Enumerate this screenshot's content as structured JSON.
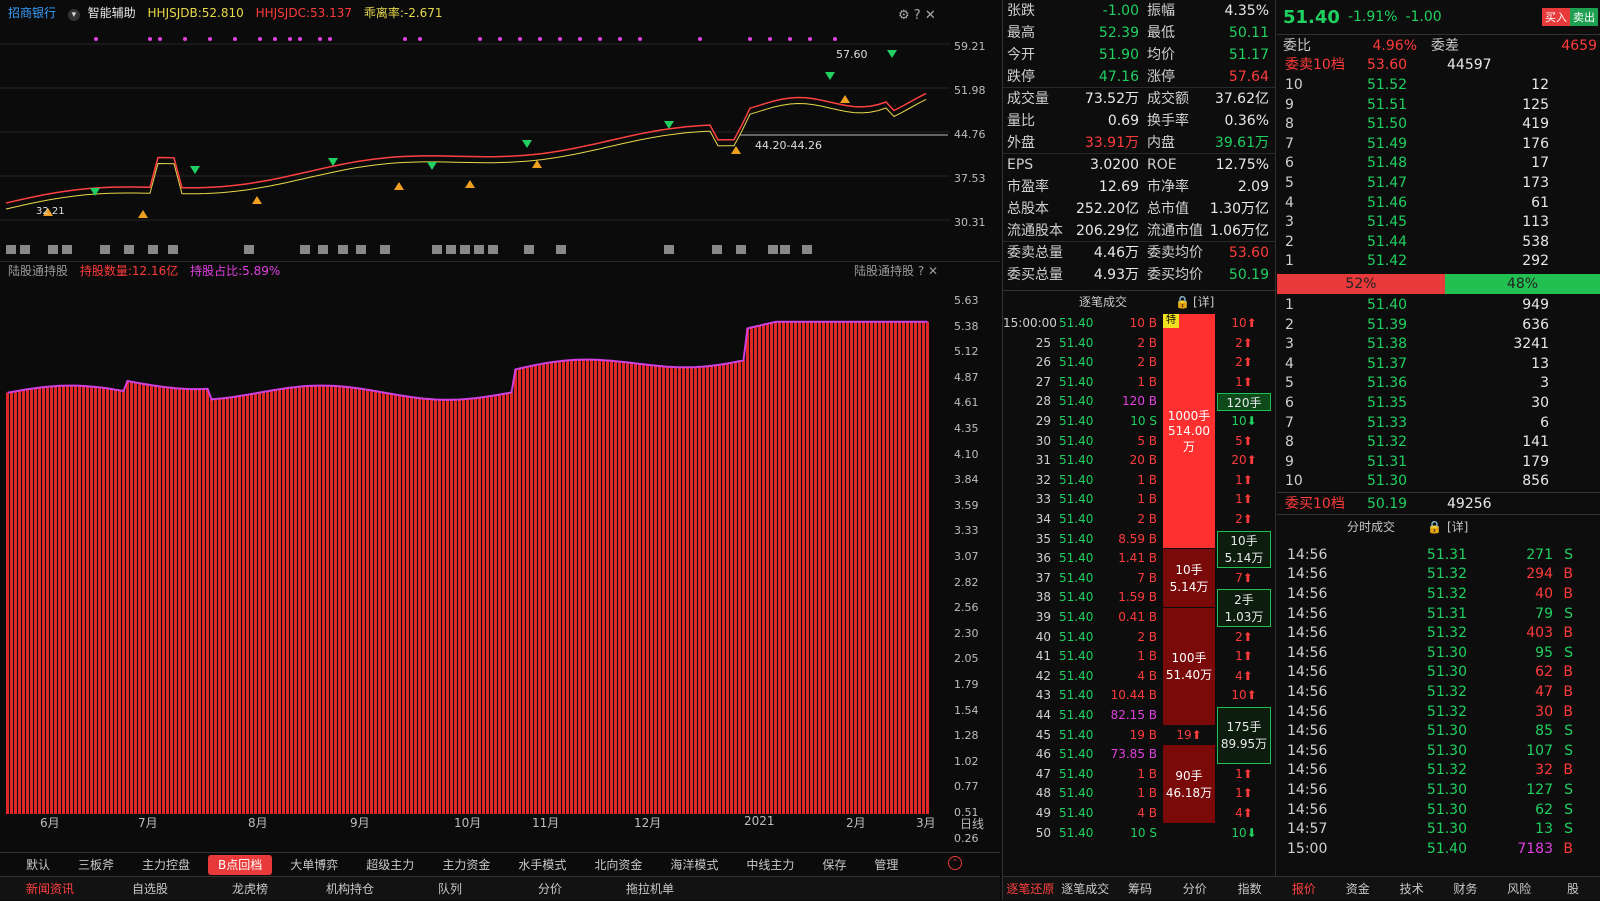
{
  "header": {
    "stock_name": "招商银行",
    "assist_label": "智能辅助",
    "ind1": "HHJSJDB:52.810",
    "ind2": "HHJSJDC:53.137",
    "ind3": "乖离率:-2.671"
  },
  "price_axis": [
    "59.21",
    "51.98",
    "44.76",
    "37.53",
    "30.31"
  ],
  "price_annotations": {
    "high": "57.60",
    "support": "44.20-44.26",
    "low": "32.21"
  },
  "sub_header": {
    "title": "陆股通持股",
    "qty": "持股数量:12.16亿",
    "ratio": "持股占比:5.89%",
    "right_title": "陆股通持股"
  },
  "sub_axis": [
    "5.63",
    "5.38",
    "5.12",
    "4.87",
    "4.61",
    "4.35",
    "4.10",
    "3.84",
    "3.59",
    "3.33",
    "3.07",
    "2.82",
    "2.56",
    "2.30",
    "2.05",
    "1.79",
    "1.54",
    "1.28",
    "1.02",
    "0.77",
    "0.51",
    "0.26"
  ],
  "x_axis": [
    "6月",
    "7月",
    "8月",
    "9月",
    "10月",
    "11月",
    "12月",
    "2021",
    "2月",
    "3月"
  ],
  "period": "日线",
  "mode_tabs": [
    "默认",
    "三板斧",
    "主力控盘",
    "B点回档",
    "大单博弈",
    "超级主力",
    "主力资金",
    "水手模式",
    "北向资金",
    "海洋模式",
    "中线主力",
    "保存",
    "管理"
  ],
  "active_mode": "B点回档",
  "bottom_tabs": [
    "新闻资讯",
    "自选股",
    "龙虎榜",
    "机构持仓",
    "队列",
    "分价",
    "拖拉机单"
  ],
  "quote": [
    {
      "k": "张跌",
      "v": "-1.00",
      "c": "grn",
      "k2": "振幅",
      "v2": "4.35%",
      "c2": "wht"
    },
    {
      "k": "最高",
      "v": "52.39",
      "c": "grn",
      "k2": "最低",
      "v2": "50.11",
      "c2": "grn"
    },
    {
      "k": "今开",
      "v": "51.90",
      "c": "grn",
      "k2": "均价",
      "v2": "51.17",
      "c2": "grn"
    },
    {
      "k": "跌停",
      "v": "47.16",
      "c": "grn",
      "k2": "涨停",
      "v2": "57.64",
      "c2": "red"
    },
    {
      "k": "成交量",
      "v": "73.52万",
      "c": "wht",
      "k2": "成交额",
      "v2": "37.62亿",
      "c2": "wht"
    },
    {
      "k": "量比",
      "v": "0.69",
      "c": "wht",
      "k2": "换手率",
      "v2": "0.36%",
      "c2": "wht"
    },
    {
      "k": "外盘",
      "v": "33.91万",
      "c": "red",
      "k2": "内盘",
      "v2": "39.61万",
      "c2": "grn"
    },
    {
      "k": "EPS",
      "v": "3.0200",
      "c": "wht",
      "k2": "ROE",
      "v2": "12.75%",
      "c2": "wht"
    },
    {
      "k": "市盈率",
      "v": "12.69",
      "c": "wht",
      "k2": "市净率",
      "v2": "2.09",
      "c2": "wht"
    },
    {
      "k": "总股本",
      "v": "252.20亿",
      "c": "wht",
      "k2": "总市值",
      "v2": "1.30万亿",
      "c2": "wht"
    },
    {
      "k": "流通股本",
      "v": "206.29亿",
      "c": "wht",
      "k2": "流通市值",
      "v2": "1.06万亿",
      "c2": "wht"
    },
    {
      "k": "委卖总量",
      "v": "4.46万",
      "c": "wht",
      "k2": "委卖均价",
      "v2": "53.60",
      "c2": "red"
    },
    {
      "k": "委买总量",
      "v": "4.93万",
      "c": "wht",
      "k2": "委买均价",
      "v2": "50.19",
      "c2": "grn"
    }
  ],
  "tick_header": {
    "title": "逐笔成交",
    "detail": "[详]"
  },
  "ticks": [
    {
      "t": "15:00:00",
      "p": "51.40",
      "v": "10 B",
      "vc": "red",
      "s": "10⬆",
      "sc": "red"
    },
    {
      "t": "25",
      "p": "51.40",
      "v": "2 B",
      "vc": "red",
      "s": "2⬆",
      "sc": "red"
    },
    {
      "t": "26",
      "p": "51.40",
      "v": "2 B",
      "vc": "red",
      "s": "2⬆",
      "sc": "red"
    },
    {
      "t": "27",
      "p": "51.40",
      "v": "1 B",
      "vc": "red",
      "s": "1⬆",
      "sc": "red"
    },
    {
      "t": "28",
      "p": "51.40",
      "v": "120 B",
      "vc": "mag",
      "s": "",
      "sc": "red"
    },
    {
      "t": "29",
      "p": "51.40",
      "v": "10 S",
      "vc": "grn",
      "s": "10⬇",
      "sc": "grn"
    },
    {
      "t": "30",
      "p": "51.40",
      "v": "5 B",
      "vc": "red",
      "s": "5⬆",
      "sc": "red"
    },
    {
      "t": "31",
      "p": "51.40",
      "v": "20 B",
      "vc": "red",
      "s": "20⬆",
      "sc": "red"
    },
    {
      "t": "32",
      "p": "51.40",
      "v": "1 B",
      "vc": "red",
      "s": "1⬆",
      "sc": "red"
    },
    {
      "t": "33",
      "p": "51.40",
      "v": "1 B",
      "vc": "red",
      "s": "1⬆",
      "sc": "red"
    },
    {
      "t": "34",
      "p": "51.40",
      "v": "2 B",
      "vc": "red",
      "s": "2⬆",
      "sc": "red"
    },
    {
      "t": "35",
      "p": "51.40",
      "v": "8.59 B",
      "vc": "red",
      "s": "",
      "sc": "red"
    },
    {
      "t": "36",
      "p": "51.40",
      "v": "1.41 B",
      "vc": "red",
      "s": "",
      "sc": "red"
    },
    {
      "t": "37",
      "p": "51.40",
      "v": "7 B",
      "vc": "red",
      "s": "7⬆",
      "sc": "red"
    },
    {
      "t": "38",
      "p": "51.40",
      "v": "1.59 B",
      "vc": "red",
      "s": "",
      "sc": "red"
    },
    {
      "t": "39",
      "p": "51.40",
      "v": "0.41 B",
      "vc": "red",
      "s": "",
      "sc": "red"
    },
    {
      "t": "40",
      "p": "51.40",
      "v": "2 B",
      "vc": "red",
      "s": "2⬆",
      "sc": "red"
    },
    {
      "t": "41",
      "p": "51.40",
      "v": "1 B",
      "vc": "red",
      "s": "1⬆",
      "sc": "red"
    },
    {
      "t": "42",
      "p": "51.40",
      "v": "4 B",
      "vc": "red",
      "s": "4⬆",
      "sc": "red"
    },
    {
      "t": "43",
      "p": "51.40",
      "v": "10.44 B",
      "vc": "red",
      "s": "10⬆",
      "sc": "red"
    },
    {
      "t": "44",
      "p": "51.40",
      "v": "82.15 B",
      "vc": "mag",
      "s": "",
      "sc": "red"
    },
    {
      "t": "45",
      "p": "51.40",
      "v": "19 B",
      "vc": "red",
      "s": "",
      "sc": "red"
    },
    {
      "t": "46",
      "p": "51.40",
      "v": "73.85 B",
      "vc": "mag",
      "s": "",
      "sc": "red"
    },
    {
      "t": "47",
      "p": "51.40",
      "v": "1 B",
      "vc": "red",
      "s": "1⬆",
      "sc": "red"
    },
    {
      "t": "48",
      "p": "51.40",
      "v": "1 B",
      "vc": "red",
      "s": "1⬆",
      "sc": "red"
    },
    {
      "t": "49",
      "p": "51.40",
      "v": "4 B",
      "vc": "red",
      "s": "4⬆",
      "sc": "red"
    },
    {
      "t": "50",
      "p": "51.40",
      "v": "10 S",
      "vc": "grn",
      "s": "10⬇",
      "sc": "grn"
    }
  ],
  "big_blocks": [
    {
      "a": "1000手",
      "b": "514.00万",
      "tag": "特"
    },
    {
      "a": "10手",
      "b": "5.14万"
    },
    {
      "a": "100手",
      "b": "51.40万"
    },
    {
      "a": "19⬆",
      "b": ""
    },
    {
      "a": "90手",
      "b": "46.18万"
    }
  ],
  "side_boxes": [
    {
      "a": "120手",
      "b": ""
    },
    {
      "a": "10手",
      "b": "5.14万"
    },
    {
      "a": "2手",
      "b": "1.03万"
    },
    {
      "a": "175手",
      "b": "89.95万"
    }
  ],
  "mid_tabs": [
    "逐笔还原",
    "逐笔成交",
    "筹码",
    "分价",
    "指数"
  ],
  "summary": {
    "price": "51.40",
    "pct": "-1.91%",
    "chg": "-1.00",
    "buy": "买入",
    "sell": "卖出"
  },
  "weibi": {
    "k": "委比",
    "v": "4.96%",
    "k2": "委差",
    "v2": "4659"
  },
  "sell10_header": {
    "k": "委卖10档",
    "p": "53.60",
    "q": "44597"
  },
  "asks": [
    {
      "l": "10",
      "p": "51.52",
      "q": "12"
    },
    {
      "l": "9",
      "p": "51.51",
      "q": "125"
    },
    {
      "l": "8",
      "p": "51.50",
      "q": "419"
    },
    {
      "l": "7",
      "p": "51.49",
      "q": "176"
    },
    {
      "l": "6",
      "p": "51.48",
      "q": "17"
    },
    {
      "l": "5",
      "p": "51.47",
      "q": "173"
    },
    {
      "l": "4",
      "p": "51.46",
      "q": "61"
    },
    {
      "l": "3",
      "p": "51.45",
      "q": "113"
    },
    {
      "l": "2",
      "p": "51.44",
      "q": "538"
    },
    {
      "l": "1",
      "p": "51.42",
      "q": "292"
    }
  ],
  "ratio": {
    "red": "52%",
    "green": "48%",
    "red_frac": 0.52
  },
  "bids": [
    {
      "l": "1",
      "p": "51.40",
      "q": "949"
    },
    {
      "l": "2",
      "p": "51.39",
      "q": "636"
    },
    {
      "l": "3",
      "p": "51.38",
      "q": "3241"
    },
    {
      "l": "4",
      "p": "51.37",
      "q": "13"
    },
    {
      "l": "5",
      "p": "51.36",
      "q": "3"
    },
    {
      "l": "6",
      "p": "51.35",
      "q": "30"
    },
    {
      "l": "7",
      "p": "51.33",
      "q": "6"
    },
    {
      "l": "8",
      "p": "51.32",
      "q": "141"
    },
    {
      "l": "9",
      "p": "51.31",
      "q": "179"
    },
    {
      "l": "10",
      "p": "51.30",
      "q": "856"
    }
  ],
  "buy10_footer": {
    "k": "委买10档",
    "p": "50.19",
    "q": "49256"
  },
  "fs_header": {
    "title": "分时成交",
    "detail": "[详]"
  },
  "fs": [
    {
      "t": "14:56",
      "p": "51.31",
      "v": "271",
      "s": "S"
    },
    {
      "t": "14:56",
      "p": "51.32",
      "v": "294",
      "s": "B"
    },
    {
      "t": "14:56",
      "p": "51.32",
      "v": "40",
      "s": "B"
    },
    {
      "t": "14:56",
      "p": "51.31",
      "v": "79",
      "s": "S"
    },
    {
      "t": "14:56",
      "p": "51.32",
      "v": "403",
      "s": "B"
    },
    {
      "t": "14:56",
      "p": "51.30",
      "v": "95",
      "s": "S"
    },
    {
      "t": "14:56",
      "p": "51.30",
      "v": "62",
      "s": "B"
    },
    {
      "t": "14:56",
      "p": "51.32",
      "v": "47",
      "s": "B"
    },
    {
      "t": "14:56",
      "p": "51.32",
      "v": "30",
      "s": "B"
    },
    {
      "t": "14:56",
      "p": "51.30",
      "v": "85",
      "s": "S"
    },
    {
      "t": "14:56",
      "p": "51.30",
      "v": "107",
      "s": "S"
    },
    {
      "t": "14:56",
      "p": "51.32",
      "v": "32",
      "s": "B"
    },
    {
      "t": "14:56",
      "p": "51.30",
      "v": "127",
      "s": "S"
    },
    {
      "t": "14:56",
      "p": "51.30",
      "v": "62",
      "s": "S"
    },
    {
      "t": "14:57",
      "p": "51.30",
      "v": "13",
      "s": "S"
    },
    {
      "t": "15:00",
      "p": "51.40",
      "v": "7183",
      "s": "B"
    }
  ],
  "right_tabs": [
    "报价",
    "资金",
    "技术",
    "财务",
    "风险",
    "股"
  ],
  "colors": {
    "up": "#ff3b3b",
    "down": "#20d060",
    "accent": "#e83a3a"
  }
}
